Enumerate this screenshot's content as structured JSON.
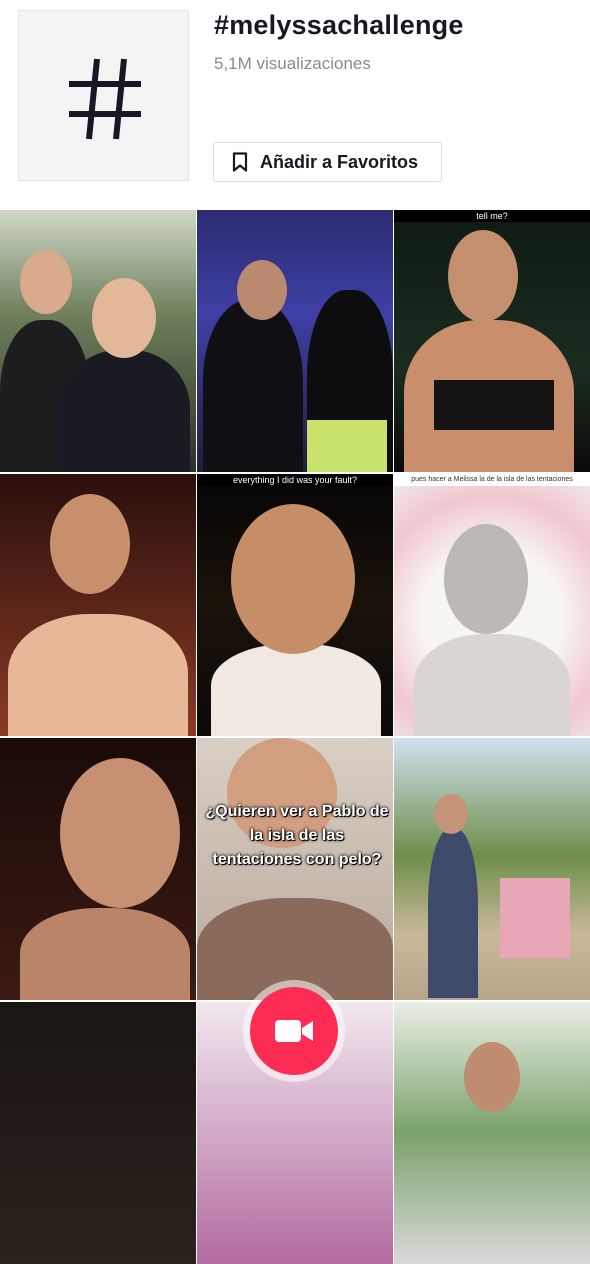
{
  "hashtag": {
    "title": "#melyssachallenge",
    "views": "5,1M visualizaciones",
    "favorite_label": "Añadir a Favoritos",
    "icons": {
      "thumb": "hashtag-icon",
      "favorite": "bookmark-icon"
    }
  },
  "videos": [
    {
      "caption": ""
    },
    {
      "caption": ""
    },
    {
      "caption": "tell me?"
    },
    {
      "caption": ""
    },
    {
      "caption": "everything I did was your fault?"
    },
    {
      "caption": "pues hacer a Melissa la de la isla de las tentaciones"
    },
    {
      "caption": ""
    },
    {
      "caption": "¿Quieren ver a Pablo de la isla de las tentaciones con pelo?"
    },
    {
      "caption": ""
    },
    {
      "caption": ""
    },
    {
      "caption": ""
    },
    {
      "caption": ""
    }
  ],
  "record_button": {
    "icon": "video-camera-icon",
    "color": "#fe2c55"
  },
  "colors": {
    "text": "#161823",
    "muted": "#8a8b91",
    "accent": "#fe2c55"
  }
}
